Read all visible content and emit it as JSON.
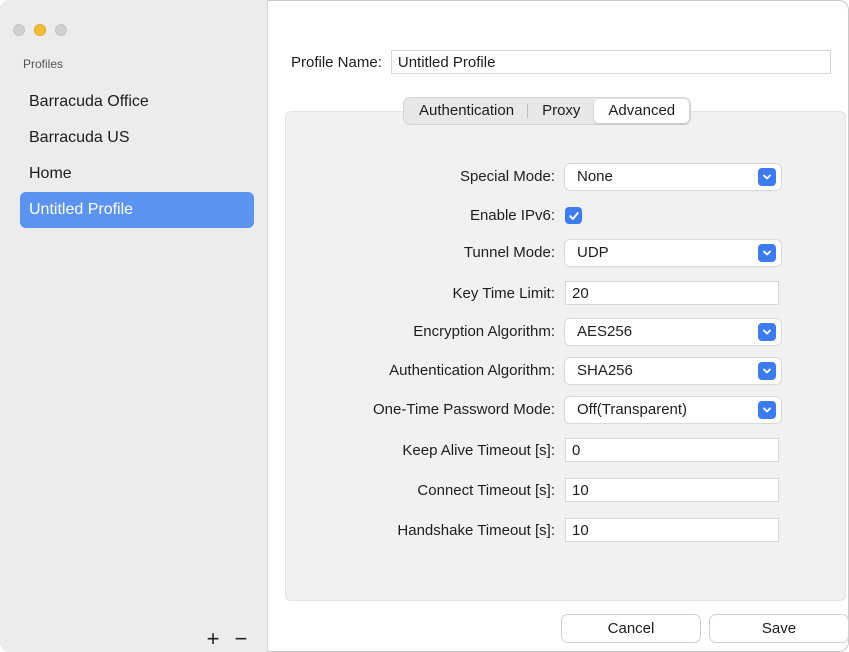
{
  "sidebar": {
    "heading": "Profiles",
    "items": [
      {
        "label": "Barracuda Office",
        "selected": false
      },
      {
        "label": "Barracuda US",
        "selected": false
      },
      {
        "label": "Home",
        "selected": false
      },
      {
        "label": "Untitled Profile",
        "selected": true
      }
    ],
    "add_label": "+",
    "remove_label": "−"
  },
  "profile": {
    "name_label": "Profile Name:",
    "name_value": "Untitled Profile"
  },
  "tabs": [
    {
      "label": "Authentication",
      "active": false
    },
    {
      "label": "Proxy",
      "active": false
    },
    {
      "label": "Advanced",
      "active": true
    }
  ],
  "advanced": {
    "special_mode": {
      "label": "Special Mode:",
      "value": "None"
    },
    "enable_ipv6": {
      "label": "Enable IPv6:",
      "checked": true
    },
    "tunnel_mode": {
      "label": "Tunnel Mode:",
      "value": "UDP"
    },
    "key_time_limit": {
      "label": "Key Time Limit:",
      "value": "20"
    },
    "encryption_algorithm": {
      "label": "Encryption Algorithm:",
      "value": "AES256"
    },
    "authentication_algorithm": {
      "label": "Authentication Algorithm:",
      "value": "SHA256"
    },
    "otp_mode": {
      "label": "One-Time Password Mode:",
      "value": "Off(Transparent)"
    },
    "keep_alive_timeout": {
      "label": "Keep Alive Timeout [s]:",
      "value": "0"
    },
    "connect_timeout": {
      "label": "Connect Timeout [s]:",
      "value": "10"
    },
    "handshake_timeout": {
      "label": "Handshake Timeout [s]:",
      "value": "10"
    }
  },
  "buttons": {
    "cancel_label": "Cancel",
    "save_label": "Save"
  },
  "colors": {
    "accent": "#3d7bf3",
    "selection": "#5a93f0",
    "minimize": "#f5bd36"
  },
  "icons": [
    "close-icon",
    "minimize-icon",
    "zoom-icon",
    "chevron-updown-icon",
    "checkmark-icon",
    "plus-icon",
    "minus-icon"
  ]
}
